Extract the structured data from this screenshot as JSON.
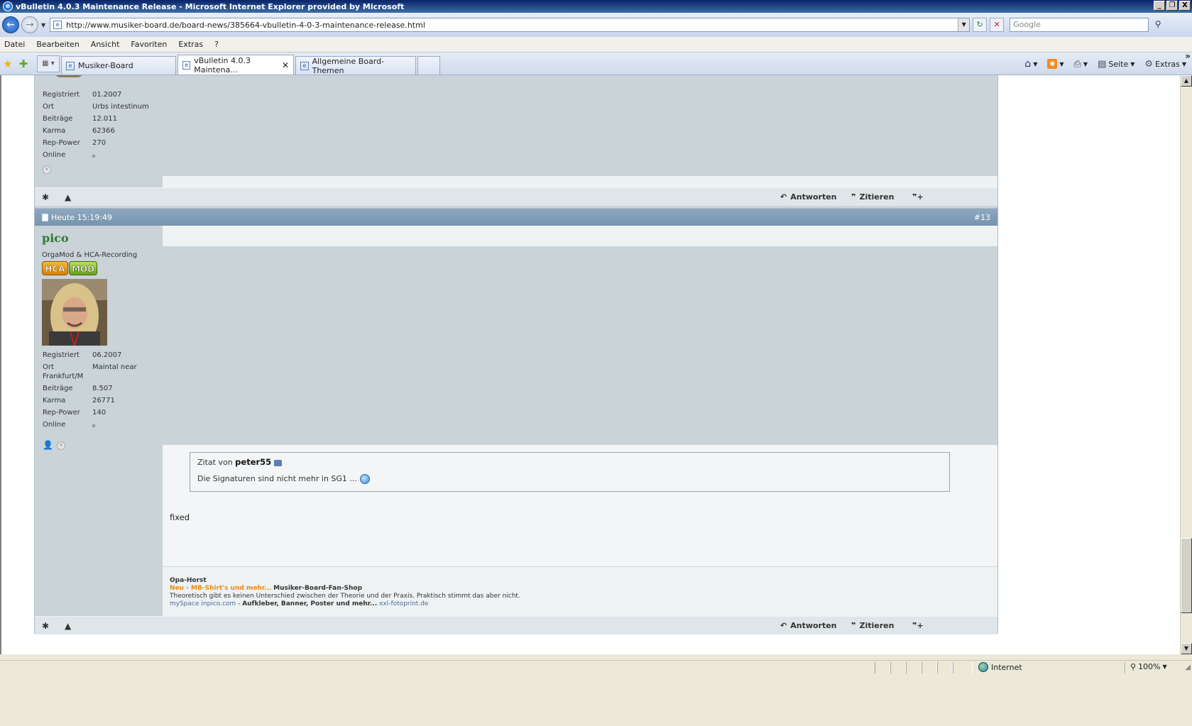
{
  "window": {
    "title": "vBulletin 4.0.3 Maintenance Release - Microsoft Internet Explorer provided by Microsoft",
    "minimize": "_",
    "restore": "❐",
    "close": "X"
  },
  "address": {
    "url": "http://www.musiker-board.de/board-news/385664-vbulletin-4-0-3-maintenance-release.html",
    "search_placeholder": "Google"
  },
  "menu": [
    "Datei",
    "Bearbeiten",
    "Ansicht",
    "Favoriten",
    "Extras",
    "?"
  ],
  "tabs": [
    {
      "label": "Musiker-Board"
    },
    {
      "label": "vBulletin 4.0.3 Maintena..."
    },
    {
      "label": "Allgemeine Board-Themen"
    }
  ],
  "commandbar": {
    "page": "Seite",
    "tools": "Extras"
  },
  "post1": {
    "stats": [
      {
        "k": "Registriert",
        "v": "01.2007"
      },
      {
        "k": "Ort",
        "v": "Urbs intestinum"
      },
      {
        "k": "Beiträge",
        "v": "12.011"
      },
      {
        "k": "Karma",
        "v": "62366"
      },
      {
        "k": "Rep-Power",
        "v": "270"
      },
      {
        "k": "Online",
        "v": ""
      }
    ],
    "reply": "Antworten",
    "quote": "Zitieren"
  },
  "post2": {
    "date": "Heute 15:19:49",
    "number": "#13",
    "username": "pico",
    "usertitle": "OrgaMod & HCA-Recording",
    "badge_hca": "HCA",
    "badge_mod": "MOD",
    "stats": [
      {
        "k": "Registriert",
        "v": "06.2007"
      },
      {
        "k": "Ort",
        "v": "Maintal near"
      },
      {
        "k": "Frankfurt/M",
        "v": ""
      },
      {
        "k": "Beiträge",
        "v": "8.507"
      },
      {
        "k": "Karma",
        "v": "26771"
      },
      {
        "k": "Rep-Power",
        "v": "140"
      },
      {
        "k": "Online",
        "v": ""
      }
    ],
    "quote_prefix": "Zitat von",
    "quote_author": "peter55",
    "quote_text": "Die Signaturen sind nicht mehr in SG1 ...",
    "message": "fixed",
    "signature": {
      "line1": "Opa-Horst",
      "line2_orange": "Neu - MB-Shirt's und mehr...",
      "line2_bold": "Musiker-Board-Fan-Shop",
      "line3": "Theoretisch gibt es keinen Unterschied zwischen der Theorie und der Praxis. Praktisch stimmt das aber nicht.",
      "line4_a": "mySpace",
      "line4_b": "inpico.com",
      "line4_sep": " - ",
      "line4_bold": "Aufkleber, Banner, Poster und mehr...",
      "line4_c": "xxl-fotoprint.de"
    },
    "reply": "Antworten",
    "quote": "Zitieren"
  },
  "status": {
    "zone": "Internet",
    "zoom": "100%"
  },
  "colors": {
    "username": "#2e7a2e",
    "post_bg": "#c9d3d8",
    "header_bg": "#7694ae"
  }
}
